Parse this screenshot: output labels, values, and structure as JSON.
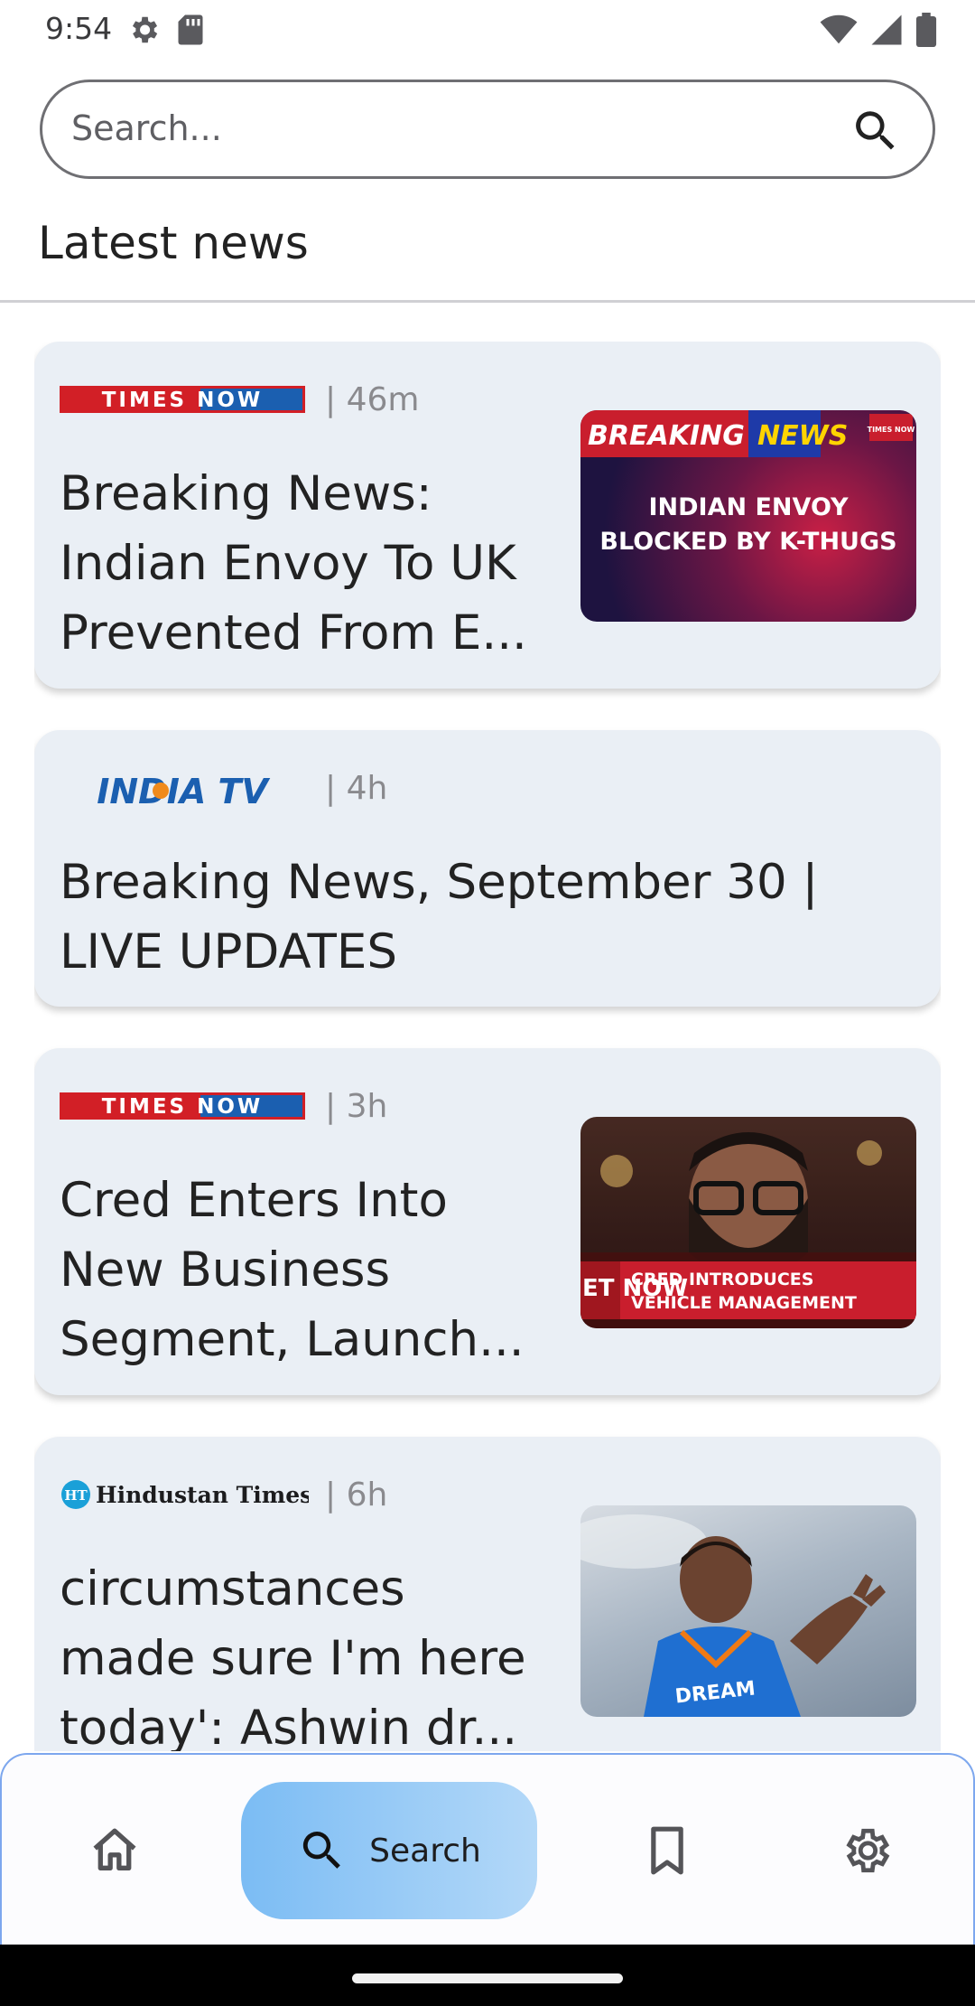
{
  "status_bar": {
    "time": "9:54"
  },
  "search": {
    "placeholder": "Search..."
  },
  "section": {
    "title": "Latest news"
  },
  "news": [
    {
      "source": "TIMES NOW",
      "age": "| 46m",
      "headline": "Breaking News:\nIndian Envoy To UK\nPrevented From E...",
      "thumb": {
        "tag_left": "BREAKING",
        "tag_right": "NEWS",
        "corner": "TIMES NOW",
        "line1": "INDIAN ENVOY",
        "line2": "BLOCKED BY K-THUGS"
      }
    },
    {
      "source": "INDIA TV",
      "age": "| 4h",
      "headline": "Breaking News, September 30 |\nLIVE UPDATES"
    },
    {
      "source": "TIMES NOW",
      "age": "| 3h",
      "headline": "Cred Enters Into\nNew Business\nSegment, Launch...",
      "thumb": {
        "side": "ET\nNOW",
        "line1": "CRED INTRODUCES",
        "line2": "VEHICLE MANAGEMENT"
      }
    },
    {
      "source": "Hindustan Times",
      "age": "| 6h",
      "headline": "circumstances\nmade sure I'm here\ntoday': Ashwin dr...",
      "thumb": {
        "jersey": "DREAM"
      }
    }
  ],
  "nav": {
    "search_label": "Search"
  },
  "colors": {
    "accent": "#7da7ee",
    "card_bg": "#eaeff5",
    "times_red": "#d21f26",
    "india_blue": "#1b5fb0"
  }
}
